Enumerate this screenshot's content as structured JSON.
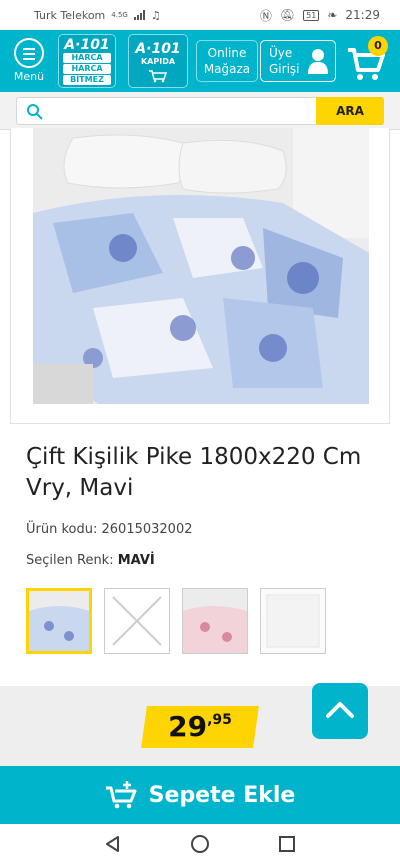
{
  "status_bar": {
    "carrier": "Turk Telekom",
    "network": "4.5G",
    "battery": "51",
    "time": "21:29"
  },
  "header": {
    "menu_label": "Menü",
    "logo_primary": {
      "brand": "A·101",
      "lines": [
        "HARCA",
        "HARCA",
        "BİTMEZ"
      ]
    },
    "logo_secondary": {
      "brand": "A·101",
      "line": "KAPIDA"
    },
    "online_store": [
      "Online",
      "Mağaza"
    ],
    "member_login": [
      "Üye",
      "Girişi"
    ],
    "cart_count": "0"
  },
  "search": {
    "placeholder": "",
    "button_label": "ARA"
  },
  "product": {
    "title": "Çift Kişilik Pike 1800x220 Cm Vry, Mavi",
    "code_label": "Ürün kodu:",
    "code": "26015032002",
    "color_label": "Seçilen Renk:",
    "color": "MAVİ",
    "price_main": "29",
    "price_cents": ",95"
  },
  "actions": {
    "add_to_cart": "Sepete Ekle"
  },
  "colors": {
    "brand": "#00b4cc",
    "accent": "#ffd400"
  }
}
